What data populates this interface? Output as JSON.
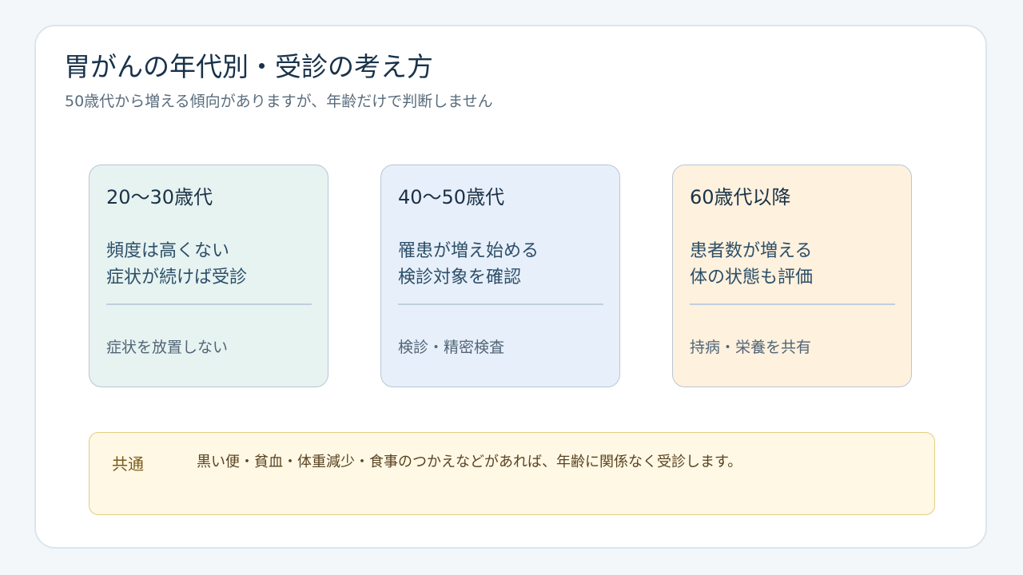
{
  "title": "胃がんの年代別・受診の考え方",
  "subtitle": "50歳代から増える傾向がありますが、年齢だけで判断しません",
  "cards": [
    {
      "heading": "20〜30歳代",
      "line1": "頻度は高くない",
      "line2": "症状が続けば受診",
      "footer": "症状を放置しない",
      "bg": "#e7f3f1"
    },
    {
      "heading": "40〜50歳代",
      "line1": "罹患が増え始める",
      "line2": "検診対象を確認",
      "footer": "検診・精密検査",
      "bg": "#e7effa"
    },
    {
      "heading": "60歳代以降",
      "line1": "患者数が増える",
      "line2": "体の状態も評価",
      "footer": "持病・栄養を共有",
      "bg": "#fef1de"
    }
  ],
  "common": {
    "label": "共通",
    "text": "黒い便・貧血・体重減少・食事のつかえなどがあれば、年齢に関係なく受診します。"
  }
}
